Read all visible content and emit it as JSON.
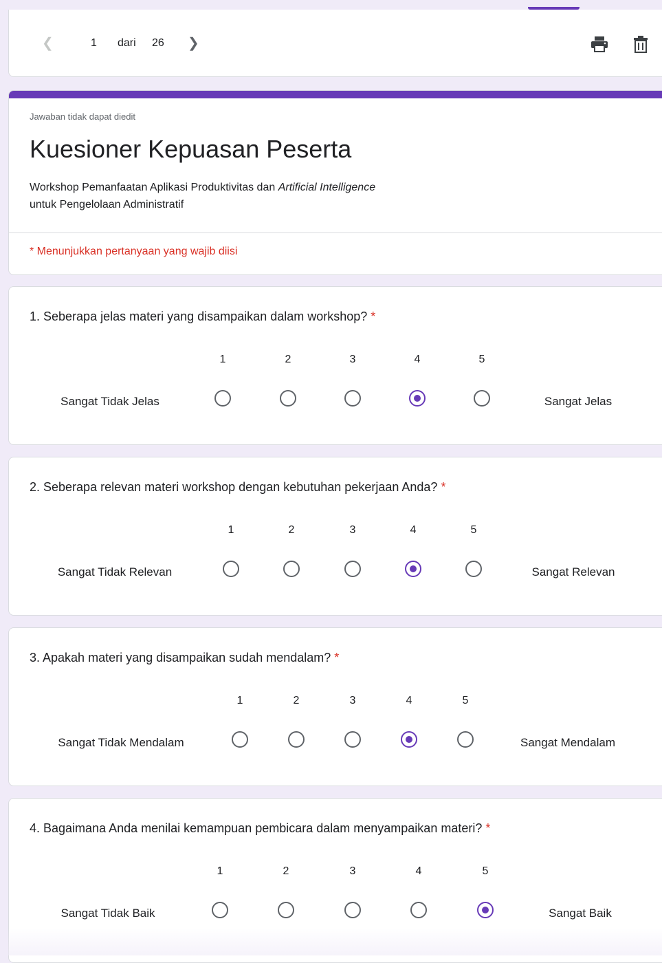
{
  "nav": {
    "current": "1",
    "of": "dari",
    "total": "26",
    "prev_icon": "chevron-left-icon",
    "next_icon": "chevron-right-icon",
    "print_icon": "print-icon",
    "delete_icon": "delete-icon"
  },
  "header": {
    "note": "Jawaban tidak dapat diedit",
    "title": "Kuesioner Kepuasan Peserta",
    "desc_part1": "Workshop Pemanfaatan Aplikasi Produktivitas dan ",
    "desc_italic1": "Artificial Intelligence",
    "desc_part2": " untuk Pengelolaan Administratif",
    "required_note": "* Menunjukkan pertanyaan yang wajib diisi"
  },
  "questions": [
    {
      "title": "1. Seberapa jelas materi yang disampaikan dalam workshop?",
      "scale": [
        "1",
        "2",
        "3",
        "4",
        "5"
      ],
      "low_label": "Sangat Tidak Jelas",
      "high_label": "Sangat Jelas",
      "selected": "4"
    },
    {
      "title": "2. Seberapa relevan materi workshop dengan kebutuhan pekerjaan Anda?",
      "scale": [
        "1",
        "2",
        "3",
        "4",
        "5"
      ],
      "low_label": "Sangat Tidak Relevan",
      "high_label": "Sangat Relevan",
      "selected": "4"
    },
    {
      "title": "3. Apakah materi yang disampaikan sudah mendalam?",
      "scale": [
        "1",
        "2",
        "3",
        "4",
        "5"
      ],
      "low_label": "Sangat Tidak Mendalam",
      "high_label": "Sangat Mendalam",
      "selected": "4"
    },
    {
      "title": "4. Bagaimana Anda menilai kemampuan pembicara dalam menyampaikan materi?",
      "scale": [
        "1",
        "2",
        "3",
        "4",
        "5"
      ],
      "low_label": "Sangat Tidak Baik",
      "high_label": "Sangat Baik",
      "selected": "5"
    }
  ],
  "required_star": "*",
  "colors": {
    "accent": "#673ab7",
    "required": "#d93025",
    "background": "#f0ebf8"
  }
}
